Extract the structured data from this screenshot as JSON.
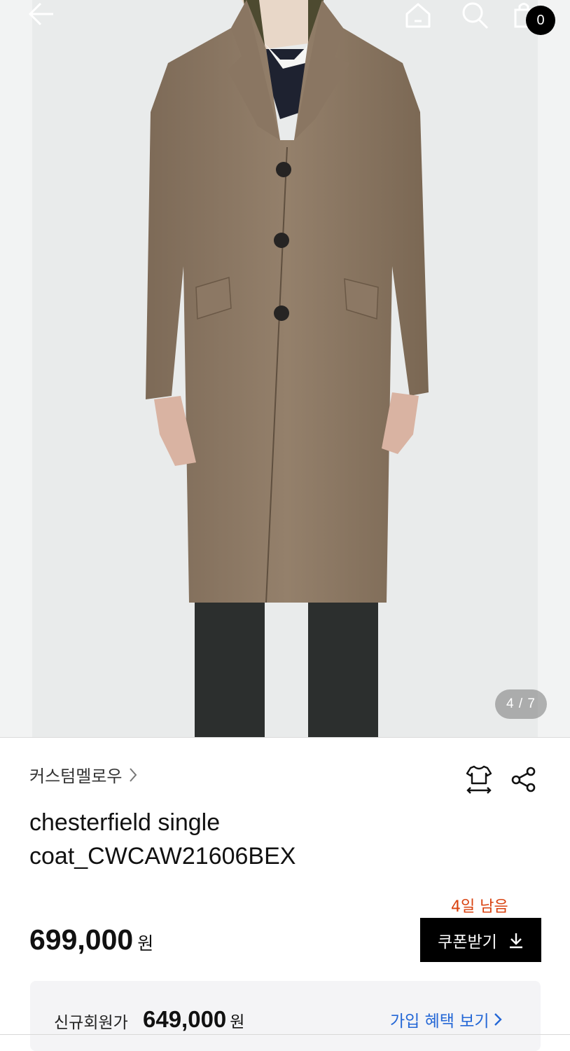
{
  "header": {
    "back_icon": "arrow-left-icon",
    "home_icon": "home-icon",
    "search_icon": "search-icon",
    "cart_icon": "shopping-bag-icon",
    "cart_count": "0"
  },
  "gallery": {
    "image": "product-photo-coat",
    "pager": "4 / 7"
  },
  "product": {
    "brand": "커스텀멜로우",
    "size_icon": "size-guide-icon",
    "share_icon": "share-icon",
    "title_line1": "chesterfield single",
    "title_line2": "coat_CWCAW21606BEX",
    "price": "699,000",
    "price_unit": "원",
    "coupon_remaining": "4일 남음",
    "coupon_button": "쿠폰받기",
    "coupon_icon": "download-icon"
  },
  "member": {
    "label": "신규회원가",
    "price": "649,000",
    "price_unit": "원",
    "link": "가입 혜택 보기",
    "link_icon": "chevron-right-icon"
  },
  "colors": {
    "accent_text": "#d9420f",
    "link": "#2467d6",
    "button_bg": "#000000"
  }
}
